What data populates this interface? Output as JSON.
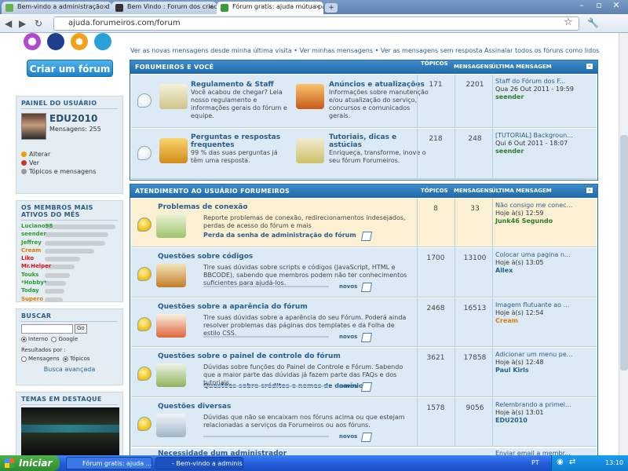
{
  "browser": {
    "tabs": [
      {
        "label": "Bem-vindo a administração d"
      },
      {
        "label": "Bem Vindo : Forum dos criador"
      },
      {
        "label": "Fórum gratis: ajuda mútua par"
      }
    ],
    "url": "ajuda.forumeiros.com/forum"
  },
  "sidebar": {
    "create_btn": "Criar um fórum",
    "user_panel": {
      "title": "PAINEL DO USUÁRIO",
      "username": "EDU2010",
      "messages": "Mensagens: 255",
      "links": [
        "Alterar",
        "Ver",
        "Tópicos e mensagens"
      ]
    },
    "members": {
      "title": "OS MEMBROS MAIS ATIVOS DO MÊS",
      "list": [
        {
          "name": "Luciano98",
          "color": "#2e9a2e",
          "pct": 1.0
        },
        {
          "name": "seender",
          "color": "#2e9a2e",
          "pct": 0.9
        },
        {
          "name": "Jeffrey",
          "color": "#2e9a2e",
          "pct": 0.85
        },
        {
          "name": "Cream",
          "color": "#e07b00",
          "pct": 0.7
        },
        {
          "name": "Liko",
          "color": "#d11",
          "pct": 0.5
        },
        {
          "name": "Mr.Helper",
          "color": "#d11",
          "pct": 0.42
        },
        {
          "name": "Touks",
          "color": "#2e9a2e",
          "pct": 0.35
        },
        {
          "name": "*Hobby*",
          "color": "#2e9a2e",
          "pct": 0.3
        },
        {
          "name": "Today",
          "color": "#2e9a2e",
          "pct": 0.28
        },
        {
          "name": "Supero",
          "color": "#e07b00",
          "pct": 0.25
        }
      ]
    },
    "search": {
      "title": "BUSCAR",
      "go": "Go",
      "opt1": "Interno",
      "opt2": "Google",
      "results_by": "Resultados por :",
      "res1": "Mensagens",
      "res2": "Tópicos",
      "advanced": "Busca avançada"
    },
    "featured": {
      "title": "TEMAS EM DESTAQUE"
    }
  },
  "toplinks": "Ver as novas mensagens desde minha última visita • Ver minhas mensagens • Ver as mensagens sem resposta  Assinalar todos os fóruns como lidos",
  "cat1": {
    "title": "FORUMEIROS E VOCÊ",
    "col_topics": "TÓPICOS",
    "col_msgs": "MENSAGENS",
    "col_last": "ÚLTIMA MENSAGEM",
    "rows": [
      {
        "a_title": "Regulamento & Staff",
        "a_desc": "Você acabou de chegar? Leia nosso regulamento e informações gerais do fórum e equipe.",
        "b_title": "Anúncios e atualizações",
        "b_desc": "Informações sobre manutenção e/ou atualização do serviço, concursos e comunicados gerais.",
        "topics": "171",
        "msgs": "2201",
        "last_title": "Staff do Fórum dos F...",
        "last_date": "Qua 26 Out 2011 - 19:59",
        "last_author": "seender"
      },
      {
        "a_title": "Perguntas e respostas frequentes",
        "a_desc": "99 % das suas perguntas já têm uma resposta.",
        "b_title": "Tutoriais, dicas e astúcias",
        "b_desc": "Enriqueça, transforme, inove o seu fórum Forumeiros.",
        "topics": "218",
        "msgs": "248",
        "last_title": "[TUTORIAL] Backgroun...",
        "last_date": "Qui 6 Out 2011 - 18:07",
        "last_author": "seender"
      }
    ]
  },
  "cat2": {
    "title": "ATENDIMENTO AO USUÁRIO FORUMEIROS",
    "col_topics": "TÓPICOS",
    "col_msgs": "MENSAGENS",
    "col_last": "ÚLTIMA MENSAGEM",
    "novos": "novos",
    "rows": [
      {
        "title": "Problemas de conexão",
        "desc": "Reporte problemas de conexão, redirecionamentos indesejados, perdas de acesso do fórum e mais",
        "sub": "Perda da senha de administração do fórum",
        "topics": "8",
        "msgs": "33",
        "last_title": "Não consigo me conec...",
        "last_date": "Hoje à(s) 12:59",
        "last_author": "Junk46 Segundo",
        "author_color": "#2e7a2e"
      },
      {
        "title": "Questões sobre códigos",
        "desc": "Tire suas dúvidas sobre scripts e códigos (JavaScript, HTML e BBCODE), sabendo que membros podem não ter conhecimentos suficientes para ajudá-los.",
        "sub": "",
        "topics": "1700",
        "msgs": "13100",
        "last_title": "Colocar uma pagina n...",
        "last_date": "Hoje à(s) 13:05",
        "last_author": "Allex",
        "author_color": "#2a5d8a"
      },
      {
        "title": "Questões sobre a aparência do fórum",
        "desc": "Tire suas dúvidas sobre a aparência do seu Fórum. Poderá ainda resolver problemas das páginas dos templates e da Folha de estilo CSS.",
        "sub": "",
        "topics": "2468",
        "msgs": "16513",
        "last_title": "Imagem flutuante ao ...",
        "last_date": "Hoje à(s) 12:54",
        "last_author": "Cream",
        "author_color": "#e07b00"
      },
      {
        "title": "Questões sobre o painel de controle do fórum",
        "desc": "Dúvidas sobre funções do Painel de Controle e Fórum. Sabendo que a maior parte das dúvidas já fazem parte das FAQs e dos tutoriais.",
        "sub": "Questões sobre créditos e nomes de domínio",
        "topics": "3621",
        "msgs": "17858",
        "last_title": "Adicionar um menu pe...",
        "last_date": "Hoje à(s) 12:48",
        "last_author": "Paul Kirls",
        "author_color": "#2a5d8a"
      },
      {
        "title": "Questões diversas",
        "desc": "Dúvidas que não se encaixam nos fóruns acima ou que estejam relacionadas a serviços da Forumeiros ou aos fóruns.",
        "sub": "",
        "topics": "1578",
        "msgs": "9056",
        "last_title": "Relembrando a primei...",
        "last_date": "Hoje à(s) 13:01",
        "last_author": "EDU2010",
        "author_color": "#2a5d8a"
      }
    ]
  },
  "cutoff_row": {
    "title": "Necessidade dum administrador",
    "last": "Enviar email a membr..."
  },
  "taskbar": {
    "start": "Iniciar",
    "btn1": "Fórum gratis: ajuda ...",
    "btn2": "- Bem-vindo a adminis...",
    "lang": "PT",
    "clock": "13:10"
  }
}
